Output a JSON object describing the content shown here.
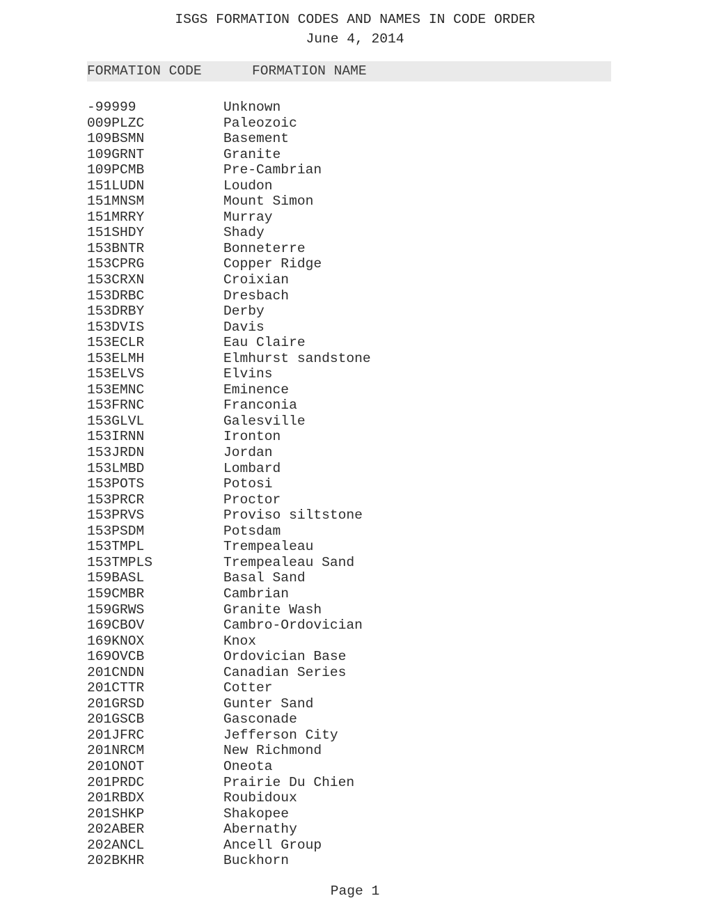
{
  "document": {
    "title": "ISGS FORMATION CODES AND NAMES IN CODE ORDER",
    "subtitle": "June 4, 2014",
    "footer": "Page 1",
    "header_band_color": "#eaeaea",
    "text_color": "#2b2b2b"
  },
  "table": {
    "columns": [
      {
        "key": "code",
        "header": "FORMATION CODE"
      },
      {
        "key": "name",
        "header": "FORMATION NAME"
      }
    ],
    "rows": [
      {
        "code": "-99999",
        "name": "Unknown"
      },
      {
        "code": "009PLZC",
        "name": "Paleozoic"
      },
      {
        "code": "109BSMN",
        "name": "Basement"
      },
      {
        "code": "109GRNT",
        "name": "Granite"
      },
      {
        "code": "109PCMB",
        "name": "Pre-Cambrian"
      },
      {
        "code": "151LUDN",
        "name": "Loudon"
      },
      {
        "code": "151MNSM",
        "name": "Mount Simon"
      },
      {
        "code": "151MRRY",
        "name": "Murray"
      },
      {
        "code": "151SHDY",
        "name": "Shady"
      },
      {
        "code": "153BNTR",
        "name": "Bonneterre"
      },
      {
        "code": "153CPRG",
        "name": "Copper Ridge"
      },
      {
        "code": "153CRXN",
        "name": "Croixian"
      },
      {
        "code": "153DRBC",
        "name": "Dresbach"
      },
      {
        "code": "153DRBY",
        "name": "Derby"
      },
      {
        "code": "153DVIS",
        "name": "Davis"
      },
      {
        "code": "153ECLR",
        "name": "Eau Claire"
      },
      {
        "code": "153ELMH",
        "name": "Elmhurst sandstone"
      },
      {
        "code": "153ELVS",
        "name": "Elvins"
      },
      {
        "code": "153EMNC",
        "name": "Eminence"
      },
      {
        "code": "153FRNC",
        "name": "Franconia"
      },
      {
        "code": "153GLVL",
        "name": "Galesville"
      },
      {
        "code": "153IRNN",
        "name": "Ironton"
      },
      {
        "code": "153JRDN",
        "name": "Jordan"
      },
      {
        "code": "153LMBD",
        "name": "Lombard"
      },
      {
        "code": "153POTS",
        "name": "Potosi"
      },
      {
        "code": "153PRCR",
        "name": "Proctor"
      },
      {
        "code": "153PRVS",
        "name": "Proviso siltstone"
      },
      {
        "code": "153PSDM",
        "name": "Potsdam"
      },
      {
        "code": "153TMPL",
        "name": "Trempealeau"
      },
      {
        "code": "153TMPLS",
        "name": "Trempealeau Sand"
      },
      {
        "code": "159BASL",
        "name": "Basal Sand"
      },
      {
        "code": "159CMBR",
        "name": "Cambrian"
      },
      {
        "code": "159GRWS",
        "name": "Granite Wash"
      },
      {
        "code": "169CBOV",
        "name": "Cambro-Ordovician"
      },
      {
        "code": "169KNOX",
        "name": "Knox"
      },
      {
        "code": "169OVCB",
        "name": "Ordovician Base"
      },
      {
        "code": "201CNDN",
        "name": "Canadian Series"
      },
      {
        "code": "201CTTR",
        "name": "Cotter"
      },
      {
        "code": "201GRSD",
        "name": "Gunter Sand"
      },
      {
        "code": "201GSCB",
        "name": "Gasconade"
      },
      {
        "code": "201JFRC",
        "name": "Jefferson City"
      },
      {
        "code": "201NRCM",
        "name": "New Richmond"
      },
      {
        "code": "201ONOT",
        "name": "Oneota"
      },
      {
        "code": "201PRDC",
        "name": "Prairie Du Chien"
      },
      {
        "code": "201RBDX",
        "name": "Roubidoux"
      },
      {
        "code": "201SHKP",
        "name": "Shakopee"
      },
      {
        "code": "202ABER",
        "name": "Abernathy"
      },
      {
        "code": "202ANCL",
        "name": "Ancell Group"
      },
      {
        "code": "202BKHR",
        "name": "Buckhorn"
      }
    ]
  }
}
